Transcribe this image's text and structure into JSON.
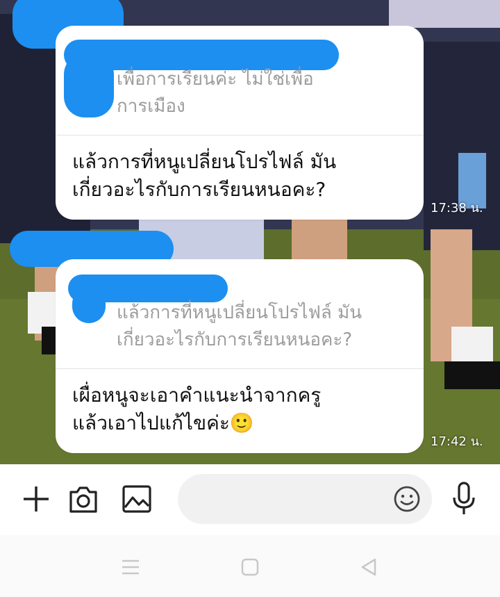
{
  "messages": [
    {
      "quote_text": "เพื่อการเรียนค่ะ ไม่ใช่เพื่อการเมือง",
      "quote_lines": [
        "เพื่อการเรียนค่ะ ไม่ใช่เพื่อ",
        "การเมือง"
      ],
      "text_lines": [
        "แล้วการที่หนูเปลี่ยนโปรไฟล์ มัน",
        "เกี่ยวอะไรกับการเรียนหนอคะ?"
      ],
      "time": "17:38 น."
    },
    {
      "quote_lines": [
        "แล้วการที่หนูเปลี่ยนโปรไฟล์ มัน",
        "เกี่ยวอะไรกับการเรียนหนอคะ?"
      ],
      "text_lines": [
        "เผื่อหนูจะเอาคำแนะนำจากครู",
        "แล้วเอาไปแก้ไขค่ะ🙂"
      ],
      "time": "17:42 น."
    }
  ],
  "input_bar": {
    "icons": [
      "plus-icon",
      "camera-icon",
      "image-icon",
      "emoji-icon",
      "microphone-icon"
    ],
    "input_value": ""
  },
  "nav_bar": {
    "icons": [
      "menu-icon",
      "home-square-icon",
      "back-triangle-icon"
    ]
  },
  "colors": {
    "bubble": "#ffffff",
    "redaction": "#1c8ff0",
    "quote_text": "#9c9c9c",
    "nav_icon": "#c8c8c8"
  }
}
